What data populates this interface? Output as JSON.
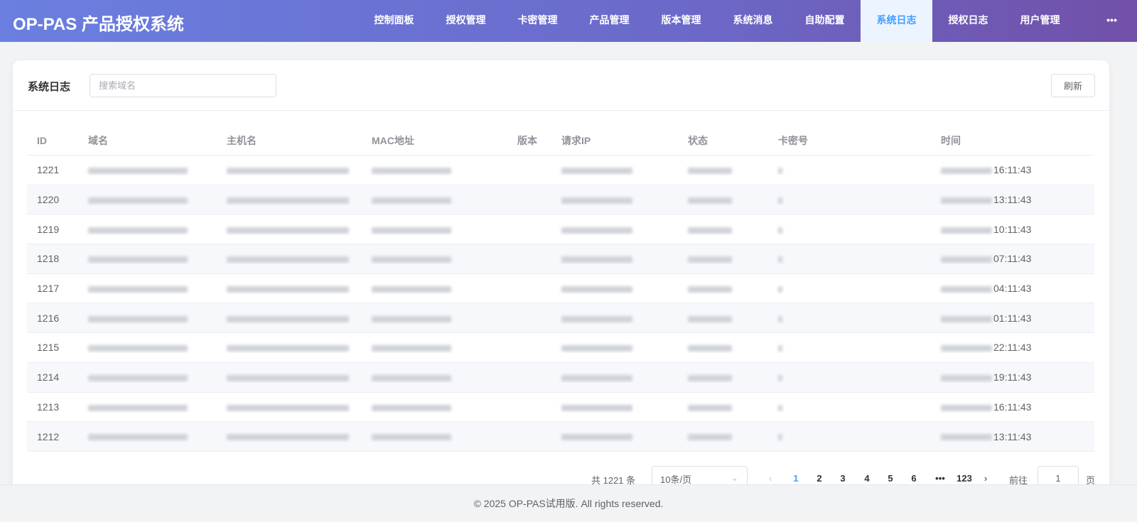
{
  "app": {
    "title": "OP-PAS 产品授权系统"
  },
  "nav": [
    {
      "label": "控制面板"
    },
    {
      "label": "授权管理"
    },
    {
      "label": "卡密管理"
    },
    {
      "label": "产品管理"
    },
    {
      "label": "版本管理"
    },
    {
      "label": "系统消息"
    },
    {
      "label": "自助配置"
    },
    {
      "label": "系统日志",
      "active": true
    },
    {
      "label": "授权日志"
    },
    {
      "label": "用户管理"
    },
    {
      "label": "•••"
    }
  ],
  "page": {
    "title": "系统日志",
    "search_placeholder": "搜索域名",
    "refresh_label": "刷新"
  },
  "table": {
    "columns": [
      "ID",
      "域名",
      "主机名",
      "MAC地址",
      "版本",
      "请求IP",
      "状态",
      "卡密号",
      "时间"
    ],
    "rows": [
      {
        "id": "1221",
        "time": "16:11:43"
      },
      {
        "id": "1220",
        "time": "13:11:43"
      },
      {
        "id": "1219",
        "time": "10:11:43"
      },
      {
        "id": "1218",
        "time": "07:11:43"
      },
      {
        "id": "1217",
        "time": "04:11:43"
      },
      {
        "id": "1216",
        "time": "01:11:43"
      },
      {
        "id": "1215",
        "time": "22:11:43"
      },
      {
        "id": "1214",
        "time": "19:11:43"
      },
      {
        "id": "1213",
        "time": "16:11:43"
      },
      {
        "id": "1212",
        "time": "13:11:43"
      }
    ]
  },
  "pagination": {
    "total": "共 1221 条",
    "page_size": "10条/页",
    "pages": [
      "1",
      "2",
      "3",
      "4",
      "5",
      "6",
      "•••",
      "123"
    ],
    "current": "1",
    "goto_label": "前往",
    "goto_value": "1",
    "page_suffix": "页",
    "prev": "‹",
    "next": "›"
  },
  "footer": {
    "text": "© 2025 OP-PAS试用版. All rights reserved."
  },
  "colors": {
    "accent": "#409eff",
    "header_start": "#6a7fe0",
    "header_end": "#7150a8"
  }
}
